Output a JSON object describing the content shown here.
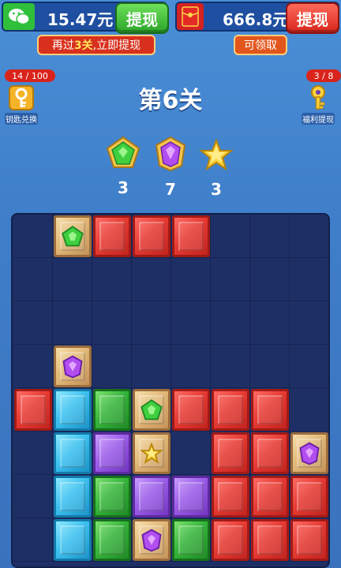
{
  "header": {
    "wallet_left": {
      "amount": "15.47元",
      "button": "提现"
    },
    "wallet_right": {
      "amount": "666.8元",
      "button": "提现"
    },
    "tip_left": {
      "prefix": "再过",
      "highlight": "3关",
      "suffix": ",立即提现"
    },
    "tip_right": "可领取"
  },
  "side_left": {
    "count": "14 / 100",
    "label": "钥匙兑换",
    "icon": "key-icon"
  },
  "side_right": {
    "count": "3 / 8",
    "label": "福利提现",
    "icon": "golden-key-icon"
  },
  "level_title": "第6关",
  "targets": [
    {
      "gem": "green-pentagon-gem",
      "count": "3"
    },
    {
      "gem": "purple-gem",
      "count": "7"
    },
    {
      "gem": "gold-star",
      "count": "3"
    }
  ],
  "board": {
    "cols": 8,
    "rows": 8,
    "cells": [
      [
        "empty",
        "gold:green",
        "red",
        "red",
        "red",
        "empty",
        "empty",
        "empty"
      ],
      [
        "empty",
        "empty",
        "empty",
        "empty",
        "empty",
        "empty",
        "empty",
        "empty"
      ],
      [
        "empty",
        "empty",
        "empty",
        "empty",
        "empty",
        "empty",
        "empty",
        "empty"
      ],
      [
        "empty",
        "gold:purple",
        "empty",
        "empty",
        "empty",
        "empty",
        "empty",
        "empty"
      ],
      [
        "red",
        "cyan",
        "green",
        "gold:green",
        "red",
        "red",
        "red",
        "empty"
      ],
      [
        "empty",
        "cyan",
        "purple",
        "gold:star",
        "empty",
        "red",
        "red",
        "gold:purple"
      ],
      [
        "empty",
        "cyan",
        "green",
        "purple",
        "purple",
        "red",
        "red",
        "red"
      ],
      [
        "empty",
        "cyan",
        "green",
        "gold:purple",
        "green",
        "red",
        "red",
        "red"
      ]
    ]
  },
  "colors": {
    "red": "#e63a33",
    "cyan": "#3cc1ef",
    "green": "#35b43a",
    "purple": "#9b5ce8",
    "gold": "#e2b877",
    "board_bg": "#1e2f66",
    "page_bg": "#3f7ec9"
  }
}
